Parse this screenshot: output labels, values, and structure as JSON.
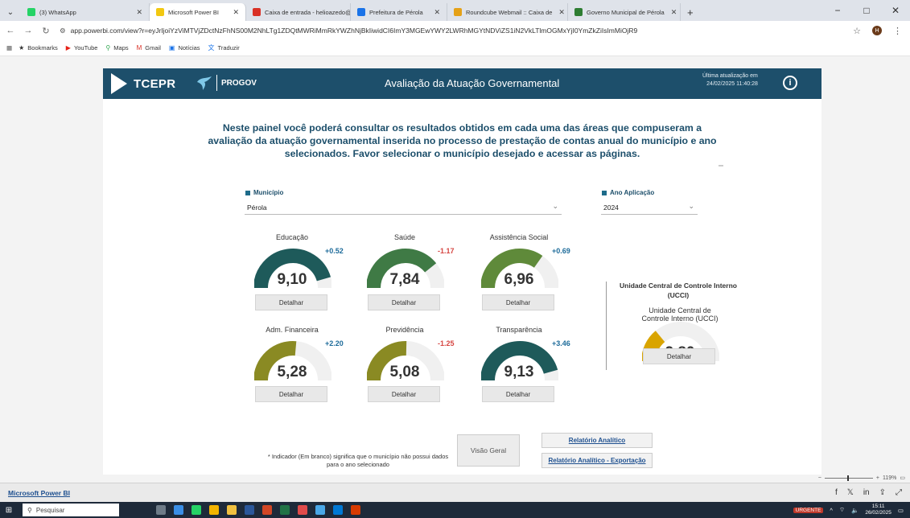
{
  "browser": {
    "tabs": [
      {
        "title": "(3) WhatsApp",
        "icon": "whatsapp-icon",
        "color": "#25d366",
        "active": false
      },
      {
        "title": "Microsoft Power BI",
        "icon": "powerbi-icon",
        "color": "#f2c811",
        "active": true
      },
      {
        "title": "Caixa de entrada - helioazedo@",
        "icon": "gmail-icon",
        "color": "#d93025",
        "active": false
      },
      {
        "title": "Prefeitura de Pérola",
        "icon": "prefeitura-icon",
        "color": "#1a73e8",
        "active": false
      },
      {
        "title": "Roundcube Webmail :: Caixa de",
        "icon": "roundcube-icon",
        "color": "#e5a117",
        "active": false
      },
      {
        "title": "Governo Municipal de Pérola",
        "icon": "governo-icon",
        "color": "#2e7d32",
        "active": false
      }
    ],
    "url": "app.powerbi.com/view?r=eyJrIjoiYzViMTVjZDctNzFhNS00M2NhLTg1ZDQtMWRiMmRkYWZhNjBkIiwidCI6ImY3MGEwYWY2LWRhMGYtNDViZS1iN2VkLTlmOGMxYjI0YmZkZiIsImMiOjR9",
    "avatar_letter": "H",
    "bookmarks": [
      {
        "label": "Bookmarks",
        "icon": "star-icon"
      },
      {
        "label": "YouTube",
        "icon": "youtube-icon"
      },
      {
        "label": "Maps",
        "icon": "maps-icon"
      },
      {
        "label": "Gmail",
        "icon": "gmail-icon"
      },
      {
        "label": "Notícias",
        "icon": "news-icon"
      },
      {
        "label": "Traduzir",
        "icon": "translate-icon"
      }
    ]
  },
  "report": {
    "logo_text": "TCEPR",
    "progov_text": "PROGOV",
    "title": "Avaliação da Atuação Governamental",
    "update_label": "Última atualização em",
    "update_value": "24/02/2025 11:40:28",
    "intro": "Neste painel você poderá consultar os resultados obtidos em cada uma das áreas que compuseram a avaliação da atuação governamental inserida no processo de prestação de contas anual do município e ano selecionados. Favor selecionar o município desejado e acessar as páginas.",
    "municipio_label": "Município",
    "municipio_value": "Pérola",
    "ano_label": "Ano Aplicação",
    "ano_value": "2024",
    "detail_label": "Detalhar",
    "gauges": [
      {
        "name": "Educação",
        "value": "9,10",
        "score": 9.1,
        "delta": "+0.52",
        "color": "#1e5a5a",
        "delta_color": "#1d6b9a"
      },
      {
        "name": "Saúde",
        "value": "7,84",
        "score": 7.84,
        "delta": "-1.17",
        "color": "#3f7a45",
        "delta_color": "#d64541"
      },
      {
        "name": "Assistência Social",
        "value": "6,96",
        "score": 6.96,
        "delta": "+0.69",
        "color": "#5f8a3a",
        "delta_color": "#1d6b9a"
      },
      {
        "name": "Adm. Financeira",
        "value": "5,28",
        "score": 5.28,
        "delta": "+2.20",
        "color": "#8a8a23",
        "delta_color": "#1d6b9a"
      },
      {
        "name": "Previdência",
        "value": "5,08",
        "score": 5.08,
        "delta": "-1.25",
        "color": "#8a8a23",
        "delta_color": "#d64541"
      },
      {
        "name": "Transparência",
        "value": "9,13",
        "score": 9.13,
        "delta": "+3.46",
        "color": "#1e5a5a",
        "delta_color": "#1d6b9a"
      }
    ],
    "ucci": {
      "name": "Unidade Central de Controle Interno (UCCI)",
      "value": "2,80",
      "score": 2.8,
      "color": "#d9a400"
    },
    "note": "* Indicador (Em branco) significa que o município não possui dados para o ano selecionado",
    "visao_geral": "Visão Geral",
    "relatorio": "Relatório Analítico",
    "relatorio_export": "Relatório Analítico - Exportação"
  },
  "powerbi": {
    "brand": "Microsoft Power BI",
    "zoom": "119%"
  },
  "taskbar": {
    "search_placeholder": "Pesquisar",
    "urgent_label": "URGENTE",
    "time": "15:11",
    "date": "26/02/2025"
  }
}
